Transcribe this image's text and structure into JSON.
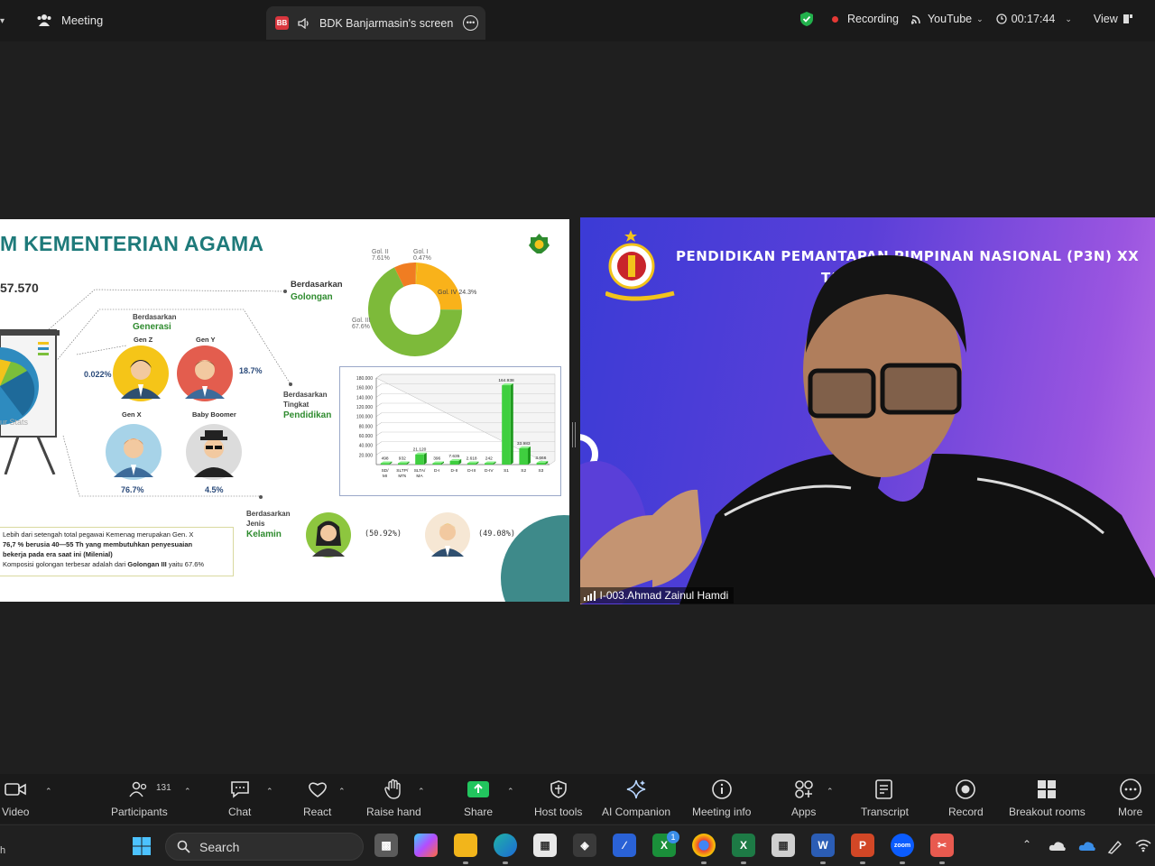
{
  "topbar": {
    "meeting_label": "Meeting",
    "screen_tab_initials": "BB",
    "screen_tab_label": "BDK Banjarmasin's screen",
    "recording_label": "Recording",
    "youtube_label": "YouTube",
    "timer": "00:17:44",
    "view_label": "View"
  },
  "slide": {
    "title": "M KEMENTERIAN AGAMA",
    "total": "57.570",
    "chart_stats_caption": "ur Stats",
    "golongan_label1": "Berdasarkan",
    "golongan_label2": "Golongan",
    "generasi_label1": "Berdasarkan",
    "generasi_label2": "Generasi",
    "pendidikan_label1": "Berdasarkan",
    "pendidikan_label2": "Tingkat",
    "pendidikan_label3": "Pendidikan",
    "kelamin_label1": "Berdasarkan",
    "kelamin_label2": "Jenis",
    "kelamin_label3": "Kelamin",
    "personas": {
      "genz": "Gen Z",
      "geny": "Gen Y",
      "genx": "Gen X",
      "boomer": "Baby Boomer",
      "genz_pct": "0.022%",
      "geny_pct": "18.7%",
      "genx_pct": "76.7%",
      "boomer_pct": "4.5%"
    },
    "pie_labels": {
      "gol2": "Gol. II",
      "gol2_pct": "7.61%",
      "gol1": "Gol. I",
      "gol1_pct": "0.47%",
      "gol4": "Gol. IV 24.3%",
      "gol3": "Gol. III",
      "gol3_pct": "67.6%"
    },
    "gender": {
      "female_pct": "(50.92%)",
      "male_pct": "(49.08%)"
    },
    "notes": {
      "line1": "Lebih dari setengah total pegawai Kemenag merupakan Gen. X",
      "line2": "76,7 %  berusia 40—55 Th yang membutuhkan penyesuaian",
      "line3": "bekerja pada era saat ini (Milenial)",
      "line4a": "Komposisi golongan terbesar adalah dari ",
      "line4b": "Golongan III",
      "line4c": " yaitu 67.6%"
    }
  },
  "chart_data": [
    {
      "type": "pie",
      "title": "Berdasarkan Golongan",
      "categories": [
        "Gol. I",
        "Gol. II",
        "Gol. III",
        "Gol. IV"
      ],
      "values": [
        0.47,
        7.61,
        67.6,
        24.3
      ],
      "colors": [
        "#e7c21a",
        "#f07d22",
        "#7dba3a",
        "#f9b21a"
      ]
    },
    {
      "type": "bar",
      "title": "Berdasarkan Tingkat Pendidikan",
      "categories": [
        "SD/ MI",
        "SLTP/ MTs",
        "SLTA/ MA",
        "D-I",
        "D-II",
        "D-III",
        "D-IV",
        "S1",
        "S2",
        "S3"
      ],
      "values": [
        498,
        932,
        21120,
        396,
        7635,
        2618,
        242,
        164938,
        33983,
        3666
      ],
      "value_labels": [
        "498",
        "932",
        "21.120",
        "396",
        "7.635",
        "2.618",
        "242",
        "164.938",
        "33.983",
        "3.666"
      ],
      "y_ticks": [
        "20.000",
        "40.000",
        "60.000",
        "80.000",
        "100.000",
        "120.000",
        "140.000",
        "160.000",
        "180.000"
      ],
      "ylim": [
        0,
        180000
      ],
      "bar_color": "#3fcf3f"
    }
  ],
  "video": {
    "banner_line1": "PENDIDIKAN PEMANTAPAN PIMPINAN NASIONAL (P3N) XX",
    "banner_line2": "TA. 2025",
    "participant_name": "I-003.Ahmad Zainul Hamdi"
  },
  "toolbar": {
    "video": "Video",
    "participants": "Participants",
    "participants_count": "131",
    "chat": "Chat",
    "react": "React",
    "raise_hand": "Raise hand",
    "share": "Share",
    "host_tools": "Host tools",
    "ai_companion": "AI Companion",
    "meeting_info": "Meeting info",
    "apps": "Apps",
    "transcript": "Transcript",
    "record": "Record",
    "breakout_rooms": "Breakout rooms",
    "more": "More"
  },
  "taskbar": {
    "search_label": "Search",
    "badge_count": "1"
  },
  "colors": {
    "zoom_blue": "#0b5cff",
    "share_green": "#22c55e",
    "recording_red": "#e53935"
  }
}
